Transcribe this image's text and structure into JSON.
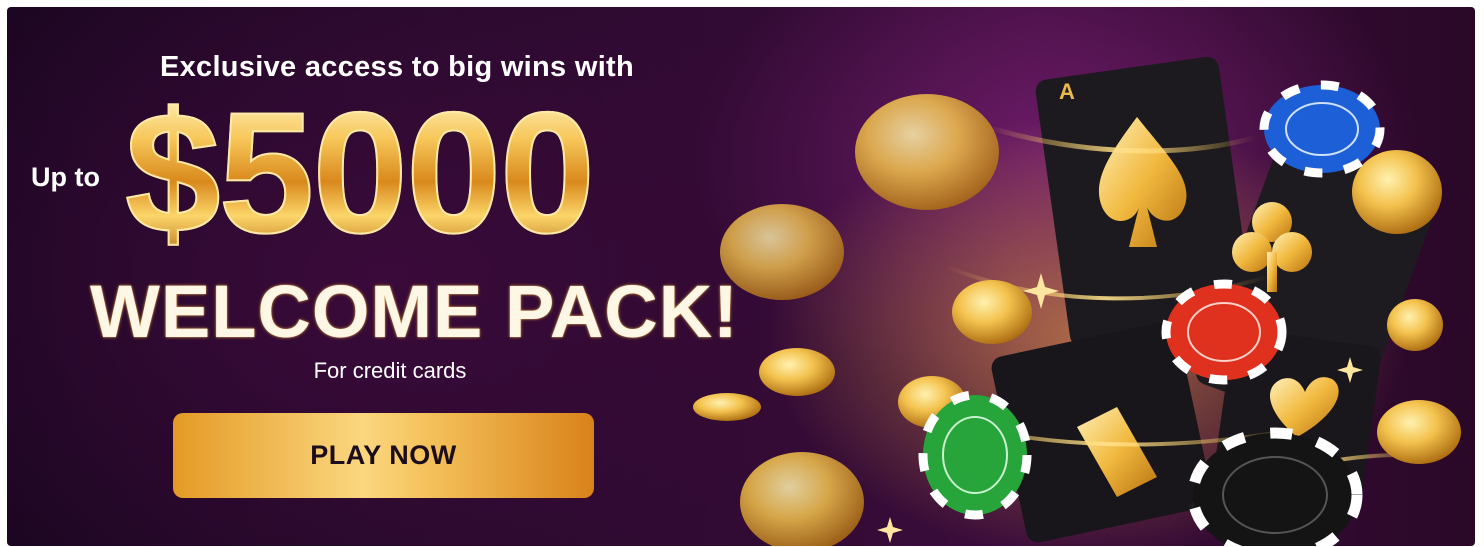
{
  "promo": {
    "headline": "Exclusive access to big wins with",
    "prefix": "Up to",
    "amount": "$5000",
    "title": "WELCOME PACK!",
    "note": "For credit cards",
    "cta_label": "PLAY NOW"
  },
  "colors": {
    "background": "#2b0a2e",
    "gold": "#f5c25c",
    "chip_blue": "#1d5fd6",
    "chip_red": "#e0311e",
    "chip_green": "#27a43a",
    "chip_black": "#141414"
  }
}
